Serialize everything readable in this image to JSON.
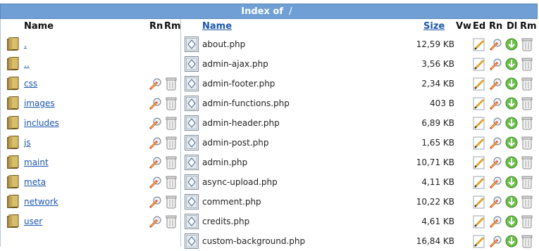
{
  "title": {
    "prefix": "Index of",
    "path": "/"
  },
  "left": {
    "headers": {
      "name": "Name",
      "rn": "Rn",
      "rm": "Rm"
    },
    "rows": [
      {
        "name": ".",
        "actions": false
      },
      {
        "name": "..",
        "actions": false
      },
      {
        "name": "css",
        "actions": true
      },
      {
        "name": "images",
        "actions": true
      },
      {
        "name": "includes",
        "actions": true
      },
      {
        "name": "js",
        "actions": true
      },
      {
        "name": "maint",
        "actions": true
      },
      {
        "name": "meta",
        "actions": true
      },
      {
        "name": "network",
        "actions": true
      },
      {
        "name": "user",
        "actions": true
      }
    ]
  },
  "right": {
    "headers": {
      "name": "Name",
      "size": "Size",
      "vw": "Vw",
      "ed": "Ed",
      "rn": "Rn",
      "dl": "Dl",
      "rm": "Rm"
    },
    "rows": [
      {
        "name": "about.php",
        "size": "12,59 KB"
      },
      {
        "name": "admin-ajax.php",
        "size": "3,56 KB"
      },
      {
        "name": "admin-footer.php",
        "size": "2,34 KB"
      },
      {
        "name": "admin-functions.php",
        "size": "403 B"
      },
      {
        "name": "admin-header.php",
        "size": "6,89 KB"
      },
      {
        "name": "admin-post.php",
        "size": "1,65 KB"
      },
      {
        "name": "admin.php",
        "size": "10,71 KB"
      },
      {
        "name": "async-upload.php",
        "size": "4,11 KB"
      },
      {
        "name": "comment.php",
        "size": "10,22 KB"
      },
      {
        "name": "credits.php",
        "size": "4,61 KB"
      },
      {
        "name": "custom-background.php",
        "size": "16,84 KB"
      }
    ]
  },
  "colors": {
    "titlebar": "#6f9fd4",
    "link": "#1a55b0"
  },
  "icons": {
    "folder": "folder-icon",
    "file": "php-file-icon",
    "rename": "rename-icon",
    "remove": "trash-icon",
    "edit": "edit-pencil-icon",
    "download": "download-icon"
  }
}
